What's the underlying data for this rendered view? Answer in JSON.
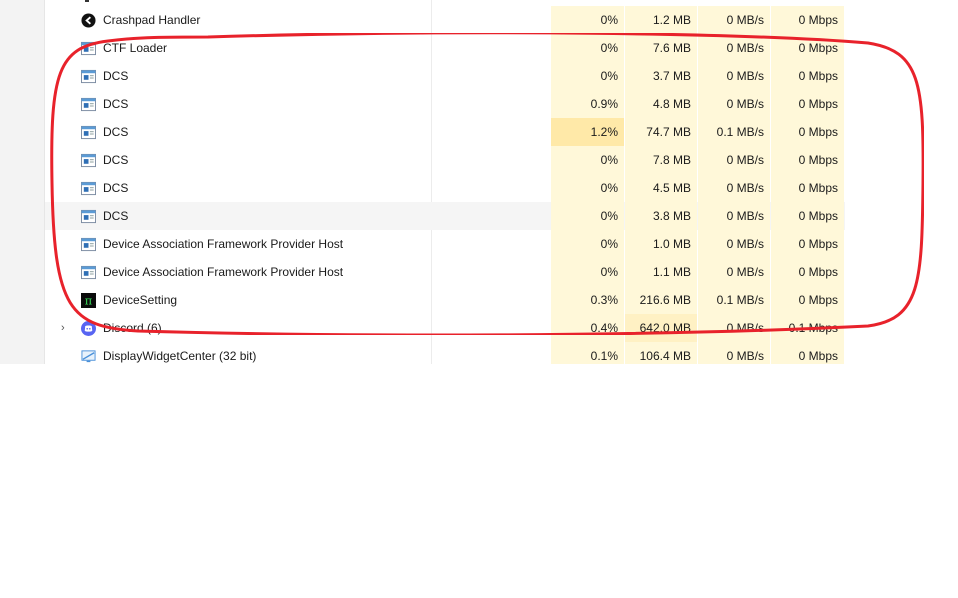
{
  "rows": [
    {
      "name": "Crashpad Handler",
      "icon": "crashpad-icon",
      "cpu": "0%",
      "mem": "1.2 MB",
      "disk": "0 MB/s",
      "net": "0 Mbps",
      "heat": {
        "cpu": 0,
        "mem": 0
      }
    },
    {
      "name": "CTF Loader",
      "icon": "window-app-icon",
      "cpu": "0%",
      "mem": "7.6 MB",
      "disk": "0 MB/s",
      "net": "0 Mbps",
      "heat": {
        "cpu": 0,
        "mem": 0
      }
    },
    {
      "name": "DCS",
      "icon": "window-app-icon",
      "cpu": "0%",
      "mem": "3.7 MB",
      "disk": "0 MB/s",
      "net": "0 Mbps",
      "heat": {
        "cpu": 0,
        "mem": 0
      }
    },
    {
      "name": "DCS",
      "icon": "window-app-icon",
      "cpu": "0.9%",
      "mem": "4.8 MB",
      "disk": "0 MB/s",
      "net": "0 Mbps",
      "heat": {
        "cpu": 0,
        "mem": 0
      }
    },
    {
      "name": "DCS",
      "icon": "window-app-icon",
      "cpu": "1.2%",
      "mem": "74.7 MB",
      "disk": "0.1 MB/s",
      "net": "0 Mbps",
      "heat": {
        "cpu": 2,
        "mem": 0
      }
    },
    {
      "name": "DCS",
      "icon": "window-app-icon",
      "cpu": "0%",
      "mem": "7.8 MB",
      "disk": "0 MB/s",
      "net": "0 Mbps",
      "heat": {
        "cpu": 0,
        "mem": 0
      }
    },
    {
      "name": "DCS",
      "icon": "window-app-icon",
      "cpu": "0%",
      "mem": "4.5 MB",
      "disk": "0 MB/s",
      "net": "0 Mbps",
      "heat": {
        "cpu": 0,
        "mem": 0
      }
    },
    {
      "name": "DCS",
      "icon": "window-app-icon",
      "cpu": "0%",
      "mem": "3.8 MB",
      "disk": "0 MB/s",
      "net": "0 Mbps",
      "heat": {
        "cpu": 0,
        "mem": 0
      },
      "hover": true
    },
    {
      "name": "Device Association Framework Provider Host",
      "icon": "window-app-icon",
      "cpu": "0%",
      "mem": "1.0 MB",
      "disk": "0 MB/s",
      "net": "0 Mbps",
      "heat": {
        "cpu": 0,
        "mem": 0
      }
    },
    {
      "name": "Device Association Framework Provider Host",
      "icon": "window-app-icon",
      "cpu": "0%",
      "mem": "1.1 MB",
      "disk": "0 MB/s",
      "net": "0 Mbps",
      "heat": {
        "cpu": 0,
        "mem": 0
      }
    },
    {
      "name": "DeviceSetting",
      "icon": "pi-icon",
      "cpu": "0.3%",
      "mem": "216.6 MB",
      "disk": "0.1 MB/s",
      "net": "0 Mbps",
      "heat": {
        "cpu": 0,
        "mem": 0
      }
    },
    {
      "name": "Discord (6)",
      "icon": "discord-icon",
      "expandable": true,
      "cpu": "0.4%",
      "mem": "642.0 MB",
      "disk": "0 MB/s",
      "net": "0.1 Mbps",
      "heat": {
        "cpu": 0,
        "mem": 1
      }
    },
    {
      "name": "DisplayWidgetCenter (32 bit)",
      "icon": "display-widget-icon",
      "cpu": "0.1%",
      "mem": "106.4 MB",
      "disk": "0 MB/s",
      "net": "0 Mbps",
      "heat": {
        "cpu": 0,
        "mem": 0
      }
    }
  ],
  "colors": {
    "annotation_stroke": "#e8222b",
    "heat_low": "#fff8d9",
    "heat_mid": "#fff1c4",
    "heat_high": "#ffe9a8"
  }
}
